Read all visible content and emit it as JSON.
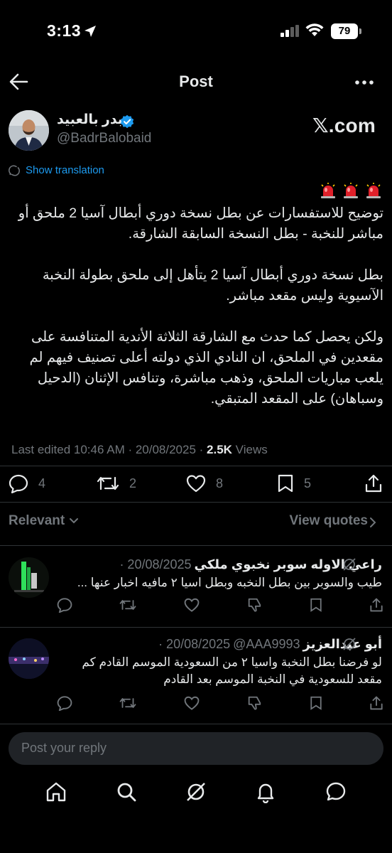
{
  "status_bar": {
    "time": "3:13",
    "battery": "79"
  },
  "header": {
    "title": "Post"
  },
  "author": {
    "name": "بدر بالعبيد",
    "handle": "@BadrBalobaid",
    "source_tag": "𝕏.com"
  },
  "translation": {
    "label": "Show translation"
  },
  "post": {
    "emoji": "🚨🚨🚨",
    "text": "توضيح للاستفسارات عن بطل نسخة دوري أبطال آسيا 2 ملحق أو مباشر للنخبة - بطل النسخة السابقة الشارقة.\n\nبطل نسخة دوري أبطال آسيا 2 يتأهل إلى ملحق بطولة النخبة الآسيوية وليس مقعد مباشر.\n\nولكن يحصل كما حدث مع الشارقة الثلاثة الأندية المتنافسة على مقعدين في الملحق، ان النادي الذي دولته أعلى تصنيف فيهم لم يلعب مباريات الملحق، وذهب مباشرة، وتنافس الإثنان (الدحيل وسباهان) على المقعد المتبقي.",
    "last_edited": "Last edited 10:46 AM · 20/08/2025 · ",
    "views_count": "2.5K",
    "views_label": " Views"
  },
  "actions": {
    "replies": "4",
    "reposts": "2",
    "likes": "8",
    "bookmarks": "5"
  },
  "filters": {
    "relevant_label": "Relevant",
    "view_quotes_label": "View quotes"
  },
  "replies": [
    {
      "name": "راعي الاوله سوبر نخبوي ملكي",
      "date": "· 20/08/2025",
      "text": "طيب والسوبر بين بطل النخبه وبطل اسيا ٢ مافيه اخبار عنها ..."
    },
    {
      "name": "أبو عبدالعزيز",
      "handle": "@AAA9993",
      "date": "· 20/08/2025",
      "text": "لو فرضنا بطل النخبة واسيا ٢ من السعودية الموسم القادم كم مقعد للسعودية في النخبة الموسم بعد القادم"
    }
  ],
  "composer": {
    "placeholder": "Post your reply"
  },
  "colors": {
    "accent": "#1d9bf0",
    "muted": "#71767b",
    "background": "#000000"
  }
}
